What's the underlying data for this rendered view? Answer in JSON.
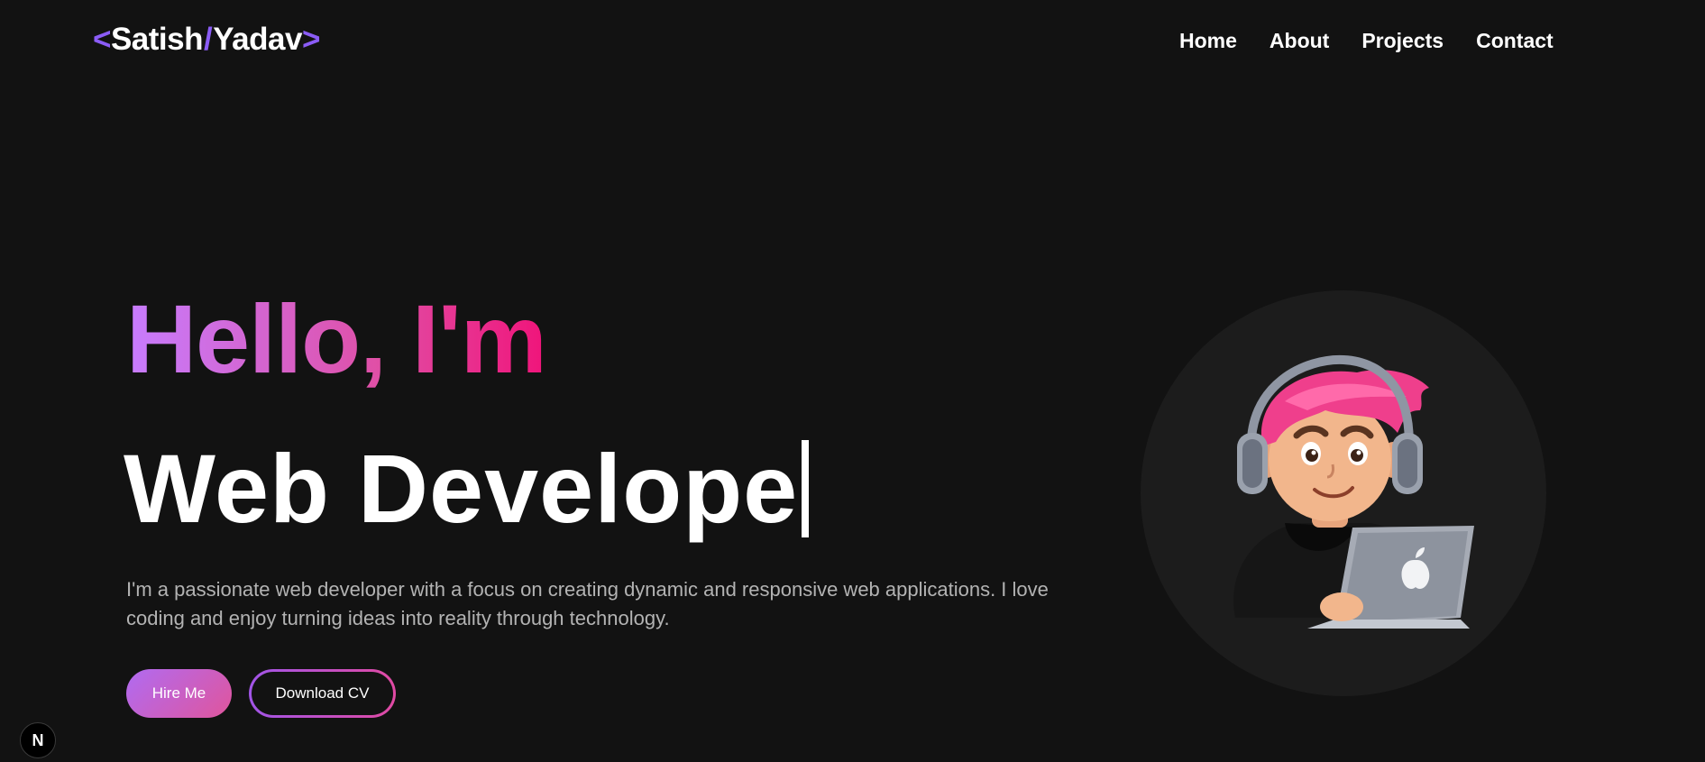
{
  "nav": {
    "logo": {
      "open": "<",
      "first": "Satish",
      "slash": "/",
      "last": "Yadav",
      "close": ">"
    },
    "links": [
      "Home",
      "About",
      "Projects",
      "Contact"
    ]
  },
  "hero": {
    "greeting": "Hello, I'm",
    "role": "Web Develope",
    "description": "I'm a passionate web developer with a focus on creating dynamic and responsive web applications. I love coding and enjoy turning ideas into reality through technology.",
    "hire_label": "Hire Me",
    "cv_label": "Download CV"
  },
  "badge": {
    "letter": "N"
  },
  "colors": {
    "background": "#121212",
    "accent_purple": "#8b5cf6",
    "gradient_start": "#c77dff",
    "gradient_end": "#f0147a",
    "avatar_bg": "#1c1c1c"
  },
  "icons": {
    "avatar": "developer-avatar-illustration",
    "badge": "nextjs-icon"
  }
}
